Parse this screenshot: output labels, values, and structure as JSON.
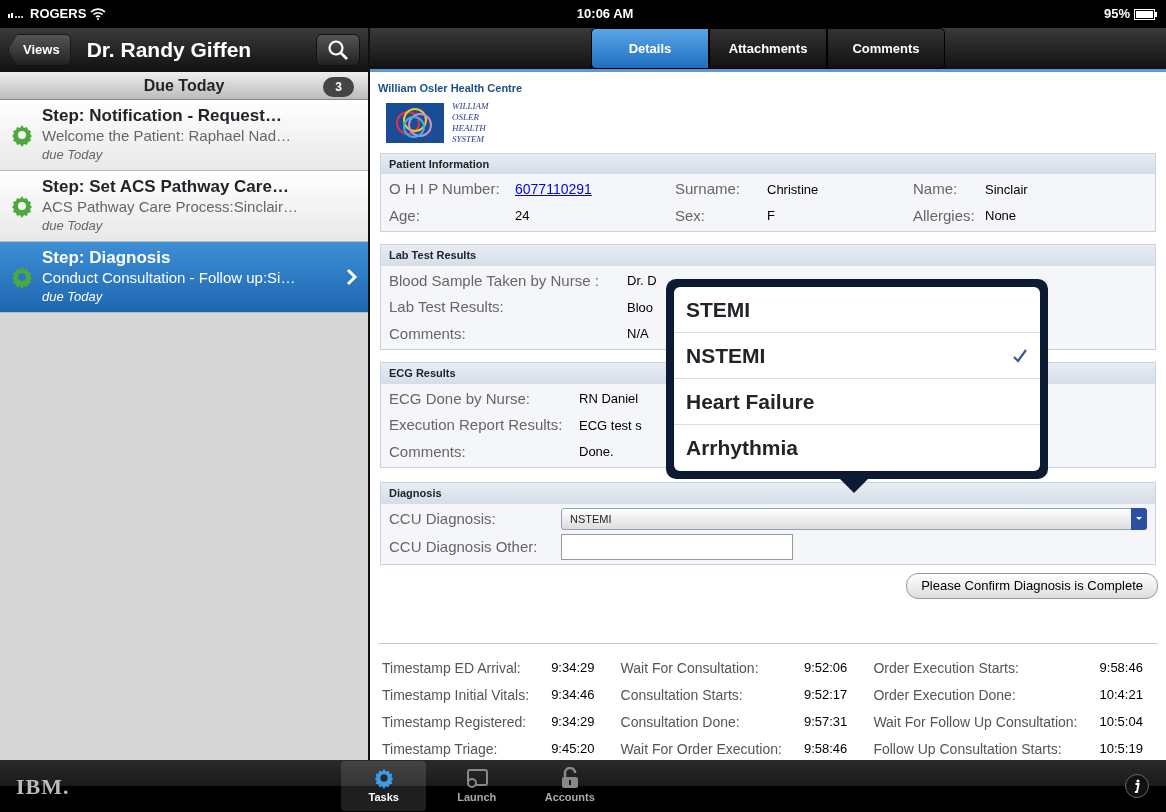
{
  "status_bar": {
    "carrier": "ROGERS",
    "time": "10:06 AM",
    "battery": "95%"
  },
  "nav": {
    "back_button": "Views",
    "title": "Dr. Randy Giffen"
  },
  "section": {
    "title": "Due Today",
    "count": "3"
  },
  "tasks": [
    {
      "title": "Step: Notification - Request…",
      "subtitle": "Welcome the Patient: Raphael Nad…",
      "due": "due Today",
      "selected": false
    },
    {
      "title": "Step: Set ACS Pathway Care…",
      "subtitle": "ACS Pathway Care Process:Sinclair…",
      "due": "due Today",
      "selected": false
    },
    {
      "title": "Step: Diagnosis",
      "subtitle": "Conduct Consultation - Follow up:Si…",
      "due": "due Today",
      "selected": true
    }
  ],
  "segments": [
    {
      "label": "Details",
      "selected": true
    },
    {
      "label": "Attachments",
      "selected": false
    },
    {
      "label": "Comments",
      "selected": false
    }
  ],
  "organization": "William Osler Health Centre",
  "logo_lines": [
    "WILLIAM",
    "OSLER",
    "HEALTH",
    "SYSTEM"
  ],
  "patient_information": {
    "title": "Patient Information",
    "fields": [
      {
        "label": "O H I P Number:",
        "value": "6077110291",
        "kind": "link"
      },
      {
        "label": "Surname:",
        "value": "Christine",
        "kind": "text"
      },
      {
        "label": "Name:",
        "value": "Sinclair",
        "kind": "text"
      },
      {
        "label": "Age:",
        "value": "24",
        "kind": "text"
      },
      {
        "label": "Sex:",
        "value": "F",
        "kind": "text"
      },
      {
        "label": "Allergies:",
        "value": "None",
        "kind": "text"
      }
    ]
  },
  "lab_test_results": {
    "title": "Lab Test Results",
    "rows": [
      {
        "label": "Blood Sample Taken by Nurse :",
        "value": "Dr. D"
      },
      {
        "label": "Lab Test Results:",
        "value": "Bloo"
      },
      {
        "label": "Comments:",
        "value": "N/A"
      }
    ]
  },
  "ecg_results": {
    "title": "ECG Results",
    "rows": [
      {
        "label": "ECG Done by Nurse:",
        "value": "RN Daniel"
      },
      {
        "label": "Execution Report Results:",
        "value": "ECG test s"
      },
      {
        "label": "Comments:",
        "value": "Done."
      }
    ]
  },
  "diagnosis": {
    "title": "Diagnosis",
    "select": {
      "label": "CCU Diagnosis:",
      "value": "NSTEMI"
    },
    "other": {
      "label": "CCU Diagnosis Other:"
    }
  },
  "confirm_button": "Please Confirm Diagnosis is Complete",
  "popover": {
    "options": [
      {
        "label": "STEMI",
        "selected": false
      },
      {
        "label": "NSTEMI",
        "selected": true
      },
      {
        "label": "Heart Failure",
        "selected": false
      },
      {
        "label": "Arrhythmia",
        "selected": false
      }
    ]
  },
  "timestamps": [
    [
      {
        "label": "Timestamp ED Arrival:",
        "value": "9:34:29"
      },
      {
        "label": "Wait For Consultation:",
        "value": "9:52:06"
      },
      {
        "label": "Order Execution Starts:",
        "value": "9:58:46"
      }
    ],
    [
      {
        "label": "Timestamp Initial Vitals:",
        "value": "9:34:46"
      },
      {
        "label": "Consultation Starts:",
        "value": "9:52:17"
      },
      {
        "label": "Order Execution Done:",
        "value": "10:4:21"
      }
    ],
    [
      {
        "label": "Timestamp Registered:",
        "value": "9:34:29"
      },
      {
        "label": "Consultation Done:",
        "value": "9:57:31"
      },
      {
        "label": "Wait For Follow Up Consultation:",
        "value": "10:5:04"
      }
    ],
    [
      {
        "label": "Timestamp Triage:",
        "value": "9:45:20"
      },
      {
        "label": "Wait For Order Execution:",
        "value": "9:58:46"
      },
      {
        "label": "Follow Up Consultation Starts:",
        "value": "10:5:19"
      }
    ]
  ],
  "tab_bar": {
    "logo": "IBM.",
    "tabs": [
      {
        "label": "Tasks",
        "selected": true
      },
      {
        "label": "Launch",
        "selected": false
      },
      {
        "label": "Accounts",
        "selected": false
      }
    ]
  }
}
